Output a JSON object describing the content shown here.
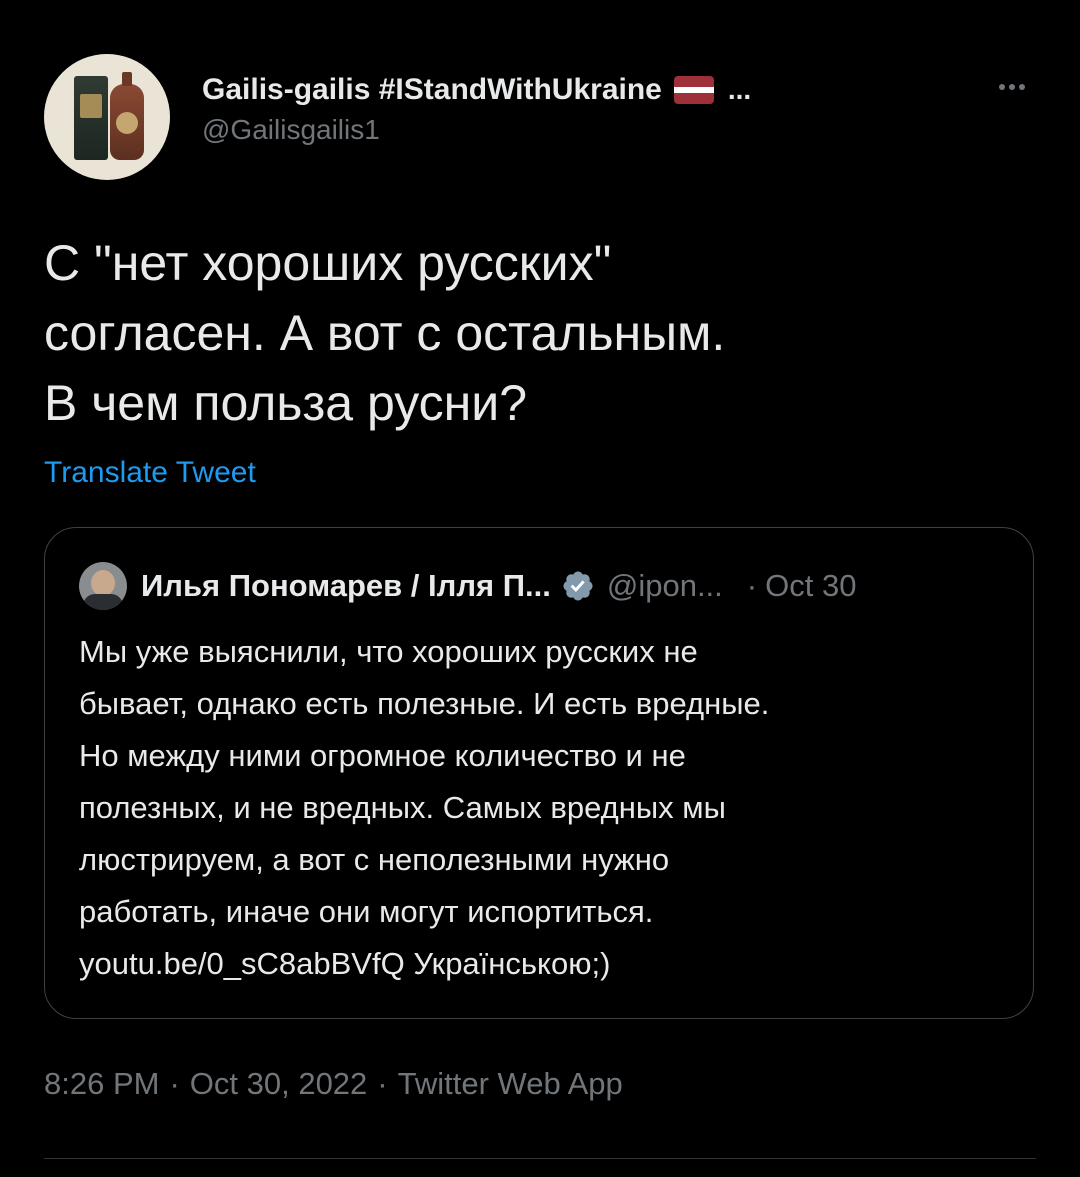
{
  "author": {
    "display_name": "Gailis-gailis #IStandWithUkraine",
    "flag_icon": "latvia-flag-icon",
    "name_ellipsis": "...",
    "handle": "@Gailisgailis1"
  },
  "more_icon": "more-horizontal-icon",
  "tweet": {
    "text": "С \"нет хороших русских\"\nсогласен. А вот с остальным.\nВ чем польза русни?",
    "translate_label": "Translate Tweet"
  },
  "quoted": {
    "name": "Илья Пономарев / Ілля П...",
    "verified_icon": "verified-badge-icon",
    "handle": "@ipon...",
    "separator": "·",
    "date": "Oct 30",
    "text": "Мы уже выяснили, что хороших русских не\nбывает, однако есть полезные. И есть вредные.\nНо между ними огромное количество и не\nполезных, и не вредных. Самых вредных мы\nлюстрируем, а вот с неполезными нужно\nработать, иначе они могут испортиться.\nyoutu.be/0_sC8abBVfQ Українською;)"
  },
  "meta": {
    "time": "8:26 PM",
    "separator": "·",
    "date": "Oct 30, 2022",
    "source": "Twitter Web App"
  },
  "colors": {
    "background": "#000000",
    "text": "#e7e9ea",
    "secondary": "#71767b",
    "link": "#1d9bf0",
    "border": "#3e4144",
    "verified": "#829aab",
    "flag_red": "#9e3039"
  }
}
